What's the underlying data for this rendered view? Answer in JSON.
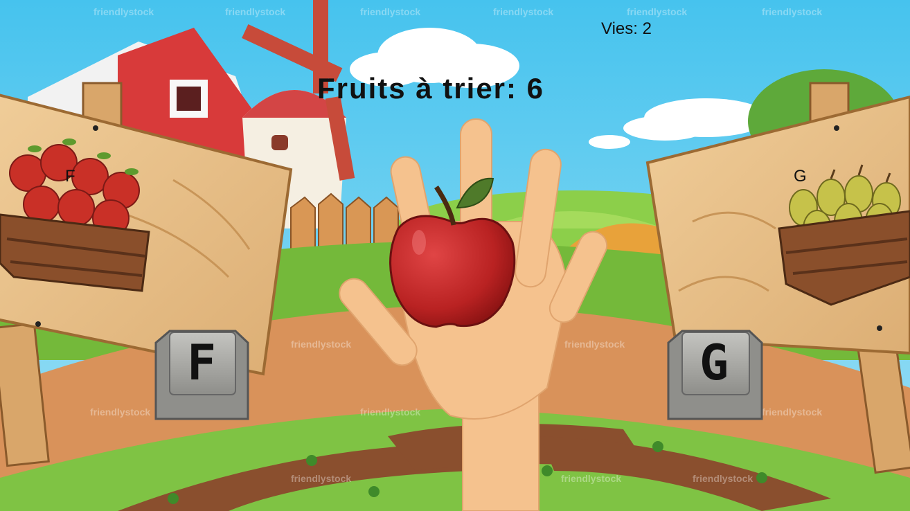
{
  "hud": {
    "lives_label": "Vies: 2",
    "counter_label": "Fruits à trier: 6"
  },
  "left_bin": {
    "fruit": "apple",
    "key_label": "F",
    "key_cap_letter": "F"
  },
  "right_bin": {
    "fruit": "pear",
    "key_label": "G",
    "key_cap_letter": "G"
  },
  "current_fruit": "apple",
  "watermark": "friendlystock",
  "colors": {
    "sky": "#5fc9ef",
    "grass": "#74b93a",
    "dirt": "#d9925a",
    "wood": "#e8c089",
    "apple": "#c92a2a",
    "pear": "#b9b83c",
    "hand": "#f5c28e",
    "key": "#a7a7a3"
  }
}
